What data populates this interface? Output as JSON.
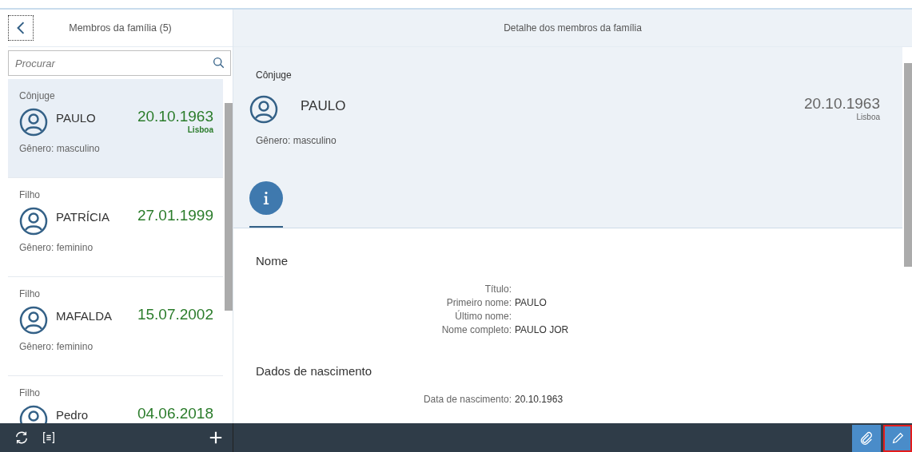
{
  "master": {
    "title": "Membros da família (5)",
    "search": {
      "placeholder": "Procurar"
    },
    "items": [
      {
        "relation": "Cônjuge",
        "name": "PAULO",
        "date": "20.10.1963",
        "place": "Lisboa",
        "gender": "Gênero: masculino",
        "selected": true
      },
      {
        "relation": "Filho",
        "name": "PATRÍCIA",
        "date": "27.01.1999",
        "gender": "Gênero: feminino",
        "selected": false
      },
      {
        "relation": "Filho",
        "name": "MAFALDA",
        "date": "15.07.2002",
        "gender": "Gênero: feminino",
        "selected": false
      },
      {
        "relation": "Filho",
        "name": "Pedro",
        "date": "04.06.2018",
        "selected": false
      }
    ]
  },
  "detail": {
    "title": "Detalhe dos membros da família",
    "header": {
      "relation": "Cônjuge",
      "name": "PAULO",
      "date": "20.10.1963",
      "place": "Lisboa",
      "gender": "Gênero: masculino"
    },
    "tabs": [
      {
        "selected": true
      }
    ],
    "sections": [
      {
        "title": "Nome",
        "fields": [
          {
            "label": "Título:"
          },
          {
            "label": "Primeiro nome:",
            "value": "PAULO"
          },
          {
            "label": "Último nome:"
          },
          {
            "label": "Nome completo:",
            "value": "PAULO JOR"
          }
        ]
      },
      {
        "title": "Dados de nascimento",
        "fields": [
          {
            "label": "Data de nascimento:",
            "value": "20.10.1963"
          }
        ]
      }
    ]
  },
  "footer": {
    "left_actions": [
      {
        "kind": "refresh"
      },
      {
        "kind": "list"
      }
    ],
    "right_actions": [
      {
        "kind": "attachment",
        "highlighted": false
      },
      {
        "kind": "edit",
        "highlighted": true
      }
    ]
  }
}
